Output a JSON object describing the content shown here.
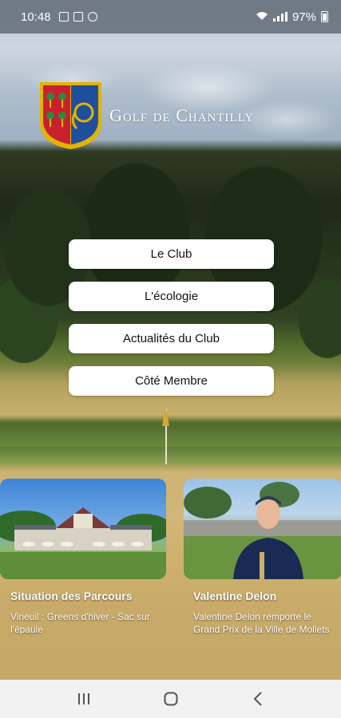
{
  "status_bar": {
    "time": "10:48",
    "battery": "97%"
  },
  "brand": {
    "name": "Golf de Chantilly",
    "colors": {
      "shield_red": "#c8202f",
      "shield_blue": "#1f4f9c",
      "shield_gold": "#e2b400",
      "tree_green": "#2c8a3e"
    }
  },
  "menu": {
    "items": [
      {
        "label": "Le Club"
      },
      {
        "label": "L'écologie"
      },
      {
        "label": "Actualités du Club"
      },
      {
        "label": "Côté Membre"
      }
    ]
  },
  "news": [
    {
      "title": "Situation des Parcours",
      "description": "Vineuil : Greens d'hiver - Sac sur l'épaule",
      "image": "clubhouse-photo"
    },
    {
      "title": "Valentine Delon",
      "description": "Valentine Delon remporte le Grand Prix de la Ville de Mollets",
      "image": "player-photo"
    }
  ],
  "nav_bar": {
    "icons": [
      "recent-apps-icon",
      "home-icon",
      "back-icon"
    ]
  }
}
